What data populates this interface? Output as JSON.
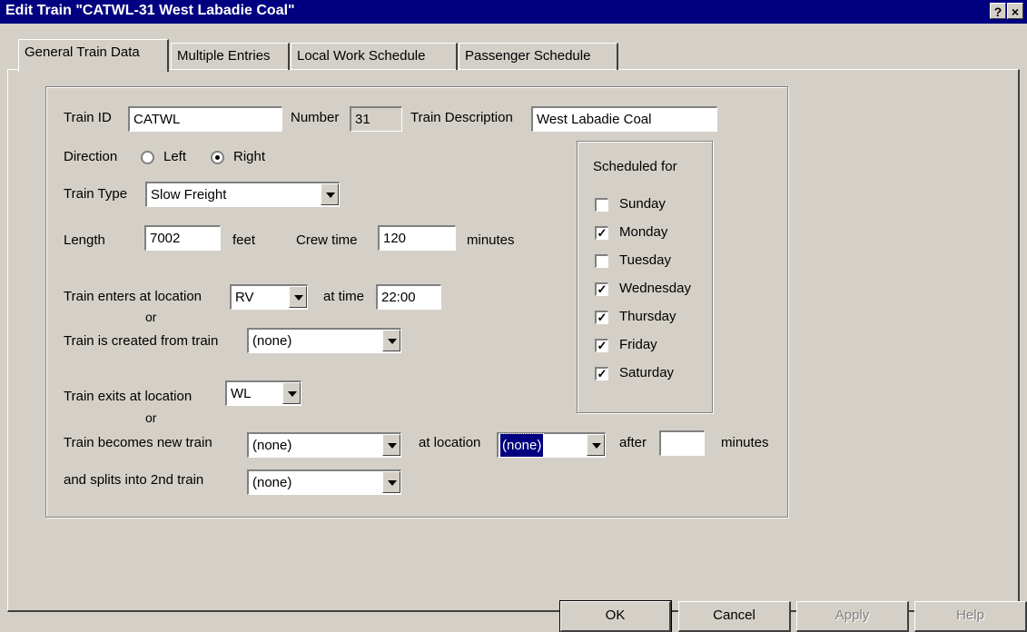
{
  "window": {
    "title": "Edit Train \"CATWL-31  West Labadie Coal\"",
    "help_glyph": "?",
    "close_glyph": "×"
  },
  "tabs": [
    {
      "label": "General Train Data",
      "active": true
    },
    {
      "label": "Multiple Entries",
      "active": false
    },
    {
      "label": "Local Work Schedule",
      "active": false
    },
    {
      "label": "Passenger Schedule",
      "active": false
    }
  ],
  "form": {
    "train_id_label": "Train ID",
    "train_id_value": "CATWL",
    "number_label": "Number",
    "number_value": "31",
    "description_label": "Train Description",
    "description_value": "West Labadie Coal",
    "direction_label": "Direction",
    "direction_left": "Left",
    "direction_right": "Right",
    "direction_selected": "Right",
    "train_type_label": "Train Type",
    "train_type_value": "Slow Freight",
    "length_label": "Length",
    "length_value": "7002",
    "length_unit": "feet",
    "crew_time_label": "Crew time",
    "crew_time_value": "120",
    "crew_time_unit": "minutes",
    "enters_label": "Train enters at location",
    "enters_value": "RV",
    "at_time_label": "at time",
    "at_time_value": "22:00",
    "or1": "or",
    "created_label": "Train is created from train",
    "created_value": "(none)",
    "exits_label": "Train exits at location",
    "exits_value": "WL",
    "or2": "or",
    "becomes_label": "Train becomes new train",
    "becomes_value": "(none)",
    "at_location_label": "at location",
    "at_location_value": "(none)",
    "after_label": "after",
    "after_value": "",
    "after_unit": "minutes",
    "splits_label": "and splits into 2nd train",
    "splits_value": "(none)"
  },
  "schedule": {
    "title": "Scheduled for",
    "days": [
      {
        "label": "Sunday",
        "checked": false
      },
      {
        "label": "Monday",
        "checked": true
      },
      {
        "label": "Tuesday",
        "checked": false
      },
      {
        "label": "Wednesday",
        "checked": true
      },
      {
        "label": "Thursday",
        "checked": true
      },
      {
        "label": "Friday",
        "checked": true
      },
      {
        "label": "Saturday",
        "checked": true
      }
    ]
  },
  "buttons": {
    "ok": "OK",
    "cancel": "Cancel",
    "apply": "Apply",
    "help": "Help"
  },
  "colors": {
    "titlebar": "#000080",
    "face": "#d4d0c8",
    "selection": "#000080"
  }
}
